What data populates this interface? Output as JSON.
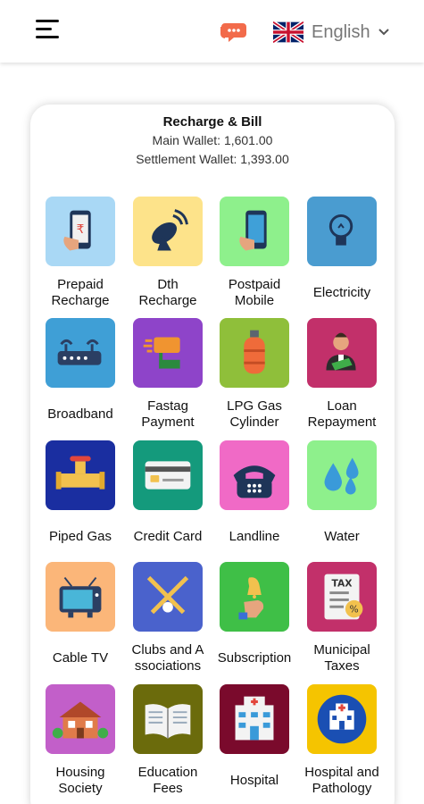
{
  "header": {
    "language": "English",
    "menu_icon": "hamburger-menu-icon",
    "chat_icon": "chat-support-icon",
    "flag_icon": "uk-flag-icon"
  },
  "card": {
    "title": "Recharge & Bill",
    "main_wallet": "Main Wallet: 1,601.00",
    "settlement_wallet": "Settlement Wallet: 1,393.00"
  },
  "services": [
    {
      "label": "Prepaid Recharge",
      "lines": [
        "Prepaid",
        "Recharge"
      ],
      "color": "#a9d8f5",
      "icon": "mobile-recharge-icon"
    },
    {
      "label": "Dth Recharge",
      "lines": [
        "Dth",
        "Recharge"
      ],
      "color": "#fde38a",
      "icon": "satellite-dish-icon"
    },
    {
      "label": "Postpaid Mobile",
      "lines": [
        "Postpaid",
        "Mobile"
      ],
      "color": "#8ef08c",
      "icon": "mobile-phone-icon"
    },
    {
      "label": "Electricity",
      "lines": [
        "Electricity"
      ],
      "color": "#4a9cd0",
      "icon": "light-bulb-icon"
    },
    {
      "label": "Broadband",
      "lines": [
        "Broadband"
      ],
      "color": "#3f9fd6",
      "icon": "router-icon"
    },
    {
      "label": "Fastag Payment",
      "lines": [
        "Fastag",
        "Payment"
      ],
      "color": "#8e44c9",
      "icon": "fastag-icon"
    },
    {
      "label": "LPG Gas Cylinder",
      "lines": [
        "LPG Gas",
        "Cylinder"
      ],
      "color": "#8fbf3a",
      "icon": "gas-cylinder-icon"
    },
    {
      "label": "Loan Repayment",
      "lines": [
        "Loan",
        "Repayment"
      ],
      "color": "#c2306a",
      "icon": "loan-person-icon"
    },
    {
      "label": "Piped Gas",
      "lines": [
        "Piped Gas"
      ],
      "color": "#1a2ea0",
      "icon": "gas-pipe-valve-icon"
    },
    {
      "label": "Credit Card",
      "lines": [
        "Credit Card"
      ],
      "color": "#149a7c",
      "icon": "credit-card-icon"
    },
    {
      "label": "Landline",
      "lines": [
        "Landline"
      ],
      "color": "#f06ac6",
      "icon": "telephone-icon"
    },
    {
      "label": "Water",
      "lines": [
        "Water"
      ],
      "color": "#8ef08c",
      "icon": "water-drops-icon"
    },
    {
      "label": "Cable TV",
      "lines": [
        "Cable TV"
      ],
      "color": "#fbb679",
      "icon": "tv-icon"
    },
    {
      "label": "Clubs and Associations",
      "lines": [
        "Clubs and A",
        "ssociations"
      ],
      "color": "#4a62cc",
      "icon": "golf-clubs-icon"
    },
    {
      "label": "Subscription",
      "lines": [
        "Subscription"
      ],
      "color": "#3fbf47",
      "icon": "bell-hand-icon"
    },
    {
      "label": "Municipal Taxes",
      "lines": [
        "Municipal",
        "Taxes"
      ],
      "color": "#c2306a",
      "icon": "tax-document-icon"
    },
    {
      "label": "Housing Society",
      "lines": [
        "Housing",
        "Society"
      ],
      "color": "#c25fc9",
      "icon": "house-icon"
    },
    {
      "label": "Education Fees",
      "lines": [
        "Education",
        "Fees"
      ],
      "color": "#6b6b0c",
      "icon": "open-book-icon"
    },
    {
      "label": "Hospital",
      "lines": [
        "Hospital"
      ],
      "color": "#7a0a2c",
      "icon": "hospital-icon"
    },
    {
      "label": "Hospital and Pathology",
      "lines": [
        "Hospital and",
        "Pathology"
      ],
      "color": "#f5c400",
      "icon": "hospital-badge-icon"
    }
  ]
}
